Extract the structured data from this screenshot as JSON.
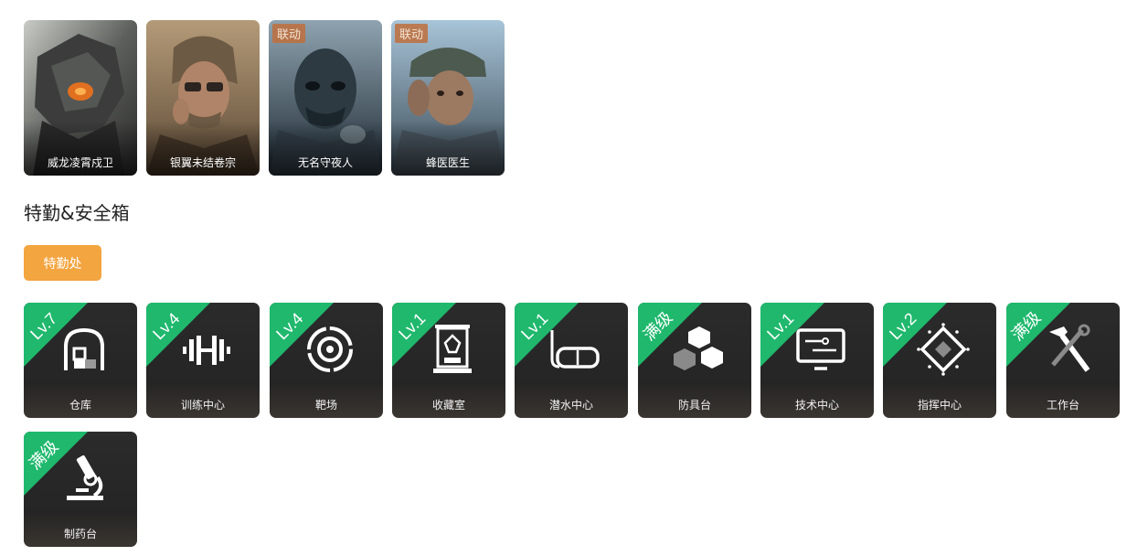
{
  "operators": [
    {
      "name": "威龙凌霄戍卫",
      "collab": ""
    },
    {
      "name": "银翼未结卷宗",
      "collab": ""
    },
    {
      "name": "无名守夜人",
      "collab": "联动"
    },
    {
      "name": "蜂医医生",
      "collab": "联动"
    }
  ],
  "section_title": "特勤&安全箱",
  "tab_label": "特勤处",
  "facilities": [
    {
      "label": "仓库",
      "level": "Lv.7",
      "icon": "storage-icon"
    },
    {
      "label": "训练中心",
      "level": "Lv.4",
      "icon": "dumbbell-icon"
    },
    {
      "label": "靶场",
      "level": "Lv.4",
      "icon": "target-icon"
    },
    {
      "label": "收藏室",
      "level": "Lv.1",
      "icon": "collection-icon"
    },
    {
      "label": "潜水中心",
      "level": "Lv.1",
      "icon": "diving-mask-icon"
    },
    {
      "label": "防具台",
      "level": "满级",
      "icon": "cubes-icon"
    },
    {
      "label": "技术中心",
      "level": "Lv.1",
      "icon": "monitor-icon"
    },
    {
      "label": "指挥中心",
      "level": "Lv.2",
      "icon": "chip-icon"
    },
    {
      "label": "工作台",
      "level": "满级",
      "icon": "tools-icon"
    },
    {
      "label": "制药台",
      "level": "满级",
      "icon": "microscope-icon"
    }
  ],
  "colors": {
    "accent": "#f3a540",
    "level_badge": "#1fb86d",
    "card_bg": "#2b2b2b"
  }
}
